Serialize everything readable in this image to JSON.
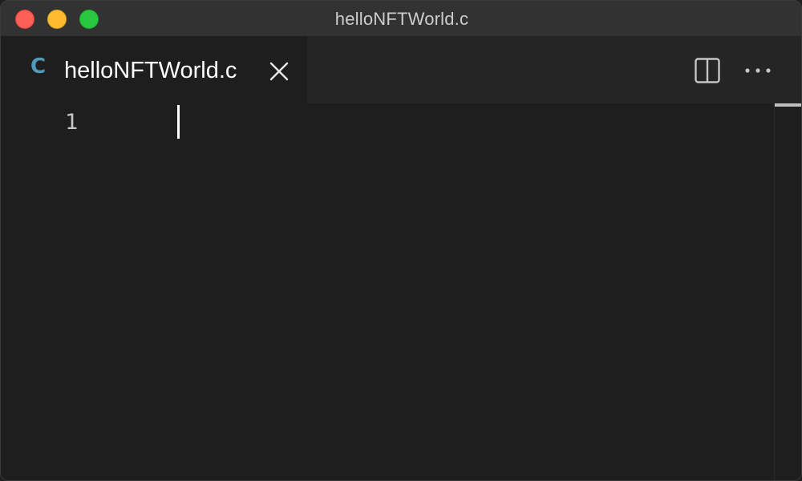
{
  "window": {
    "title": "helloNFTWorld.c"
  },
  "tab": {
    "language_icon": "C",
    "label": "helloNFTWorld.c",
    "close_icon": "close-icon"
  },
  "toolbar": {
    "split_editor_icon": "split-editor-icon",
    "more_actions_icon": "ellipsis-icon"
  },
  "editor": {
    "lines": [
      {
        "number": "1",
        "text": ""
      }
    ]
  },
  "colors": {
    "titlebar_bg": "#323233",
    "editor_bg": "#1e1e1e",
    "tab_inactive_bg": "#252526",
    "c_icon": "#519aba",
    "traffic_close": "#fe5f57",
    "traffic_minimize": "#febc2e",
    "traffic_zoom": "#28c840"
  }
}
